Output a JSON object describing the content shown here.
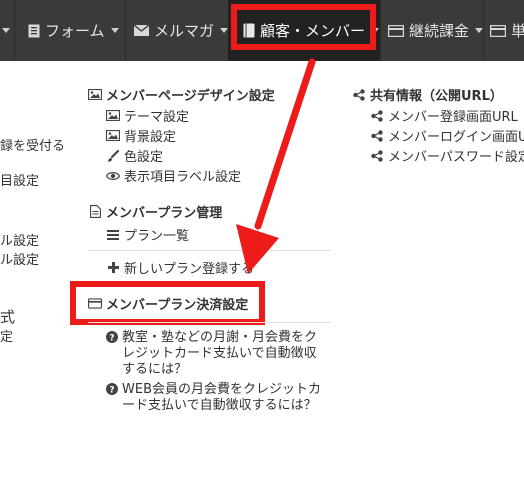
{
  "nav": {
    "item_partial": "",
    "form_label": "フォーム",
    "mail_label": "メルマガ",
    "customer_label": "顧客・メンバー",
    "billing_label": "継続課金",
    "next_label": "単"
  },
  "left_partial": {
    "l1": "録を受付る",
    "l2": "目設定",
    "l3": "ル設定",
    "l4": "ル設定",
    "l5": "式",
    "l6": "定"
  },
  "design": {
    "header": "メンバーページデザイン設定",
    "items": [
      "テーマ設定",
      "背景設定",
      "色設定",
      "表示項目ラベル設定"
    ]
  },
  "plan": {
    "header": "メンバープラン管理",
    "list_label": "プラン一覧",
    "add_label": "新しいプラン登録する"
  },
  "payment": {
    "header": "メンバープラン決済設定"
  },
  "faq": [
    [
      "教室・塾などの月謝・月会費をク",
      "レジットカード支払いで自動徴収",
      "するには？"
    ],
    [
      "WEB会員の月会費をクレジットカ",
      "ード支払いで自動徴収するには？"
    ]
  ],
  "share": {
    "header": "共有情報（公開URL）",
    "items": [
      "メンバー登録画面URL",
      "メンバーログイン画面U",
      "メンバーパスワード設定"
    ]
  },
  "colors": {
    "navbar": "#3a3a3a",
    "highlight": "#ee1b1b"
  }
}
